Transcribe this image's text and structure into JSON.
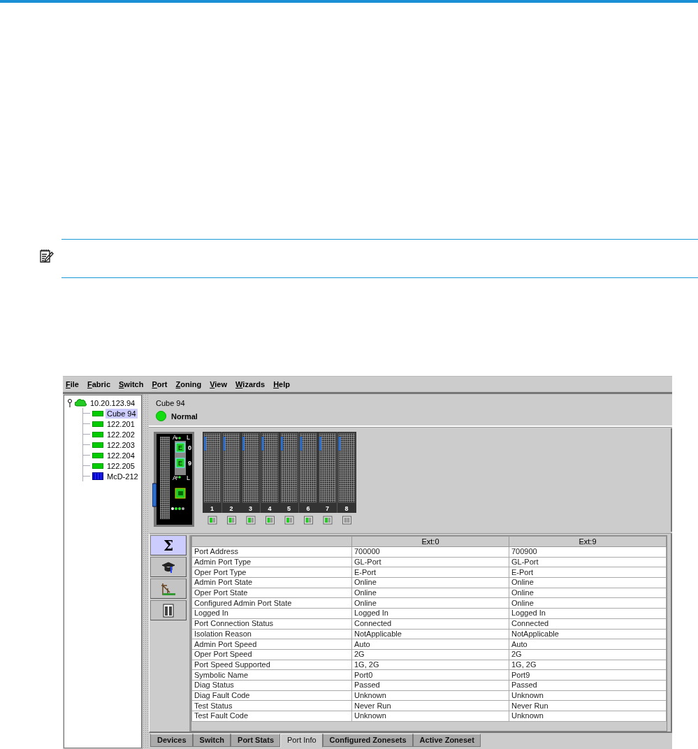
{
  "app": {
    "menu": [
      "File",
      "Fabric",
      "Switch",
      "Port",
      "Zoning",
      "View",
      "Wizards",
      "Help"
    ],
    "tree": {
      "root": {
        "label": "10.20.123.94",
        "expanded": true,
        "children": [
          {
            "label": "Cube 94",
            "kind": "switch",
            "selected": true
          },
          {
            "label": "122.201",
            "kind": "switch",
            "selected": false
          },
          {
            "label": "122.202",
            "kind": "switch",
            "selected": false
          },
          {
            "label": "122.203",
            "kind": "switch",
            "selected": false
          },
          {
            "label": "122.204",
            "kind": "switch",
            "selected": false
          },
          {
            "label": "122.205",
            "kind": "switch",
            "selected": false
          },
          {
            "label": "McD-212",
            "kind": "director",
            "selected": false
          }
        ]
      }
    },
    "header": {
      "title": "Cube 94",
      "status": "Normal"
    },
    "chassis": {
      "module": {
        "led_labels": [
          "A",
          "L",
          "A",
          "L"
        ],
        "ports": [
          {
            "type": "E",
            "number": "0"
          },
          {
            "type": "E",
            "number": "9"
          }
        ]
      },
      "slots": [
        {
          "number": "1",
          "active": true
        },
        {
          "number": "2",
          "active": true
        },
        {
          "number": "3",
          "active": true
        },
        {
          "number": "4",
          "active": true
        },
        {
          "number": "5",
          "active": true
        },
        {
          "number": "6",
          "active": true
        },
        {
          "number": "7",
          "active": true
        },
        {
          "number": "8",
          "active": false
        }
      ]
    },
    "tool_buttons": [
      {
        "kind": "symbol",
        "label": "Σ",
        "selected": true
      },
      {
        "kind": "cap",
        "selected": false
      },
      {
        "kind": "graph",
        "selected": false
      },
      {
        "kind": "ports",
        "selected": false
      }
    ],
    "table": {
      "columns": [
        "Ext:0",
        "Ext:9"
      ],
      "rows": [
        {
          "name": "Port Address",
          "values": [
            "700000",
            "700900"
          ]
        },
        {
          "name": "Admin Port Type",
          "values": [
            "GL-Port",
            "GL-Port"
          ]
        },
        {
          "name": "Oper Port Type",
          "values": [
            "E-Port",
            "E-Port"
          ]
        },
        {
          "name": "Admin Port State",
          "values": [
            "Online",
            "Online"
          ]
        },
        {
          "name": "Oper Port State",
          "values": [
            "Online",
            "Online"
          ]
        },
        {
          "name": "Configured Admin Port State",
          "values": [
            "Online",
            "Online"
          ]
        },
        {
          "name": "Logged In",
          "values": [
            "Logged In",
            "Logged In"
          ]
        },
        {
          "name": "Port Connection Status",
          "values": [
            "Connected",
            "Connected"
          ]
        },
        {
          "name": "Isolation Reason",
          "values": [
            "NotApplicable",
            "NotApplicable"
          ]
        },
        {
          "name": "Admin Port Speed",
          "values": [
            "Auto",
            "Auto"
          ]
        },
        {
          "name": "Oper Port Speed",
          "values": [
            "2G",
            "2G"
          ]
        },
        {
          "name": "Port Speed Supported",
          "values": [
            "1G, 2G",
            "1G, 2G"
          ]
        },
        {
          "name": "Symbolic Name",
          "values": [
            "Port0",
            "Port9"
          ]
        },
        {
          "name": "Diag Status",
          "values": [
            "Passed",
            "Passed"
          ]
        },
        {
          "name": "Diag Fault Code",
          "values": [
            "Unknown",
            "Unknown"
          ]
        },
        {
          "name": "Test Status",
          "values": [
            "Never Run",
            "Never Run"
          ]
        },
        {
          "name": "Test Fault Code",
          "values": [
            "Unknown",
            "Unknown"
          ]
        }
      ]
    },
    "tabs": [
      {
        "label": "Devices",
        "selected": false
      },
      {
        "label": "Switch",
        "selected": false
      },
      {
        "label": "Port Stats",
        "selected": false
      },
      {
        "label": "Port Info",
        "selected": true
      },
      {
        "label": "Configured Zonesets",
        "selected": false
      },
      {
        "label": "Active Zoneset",
        "selected": false
      }
    ]
  }
}
